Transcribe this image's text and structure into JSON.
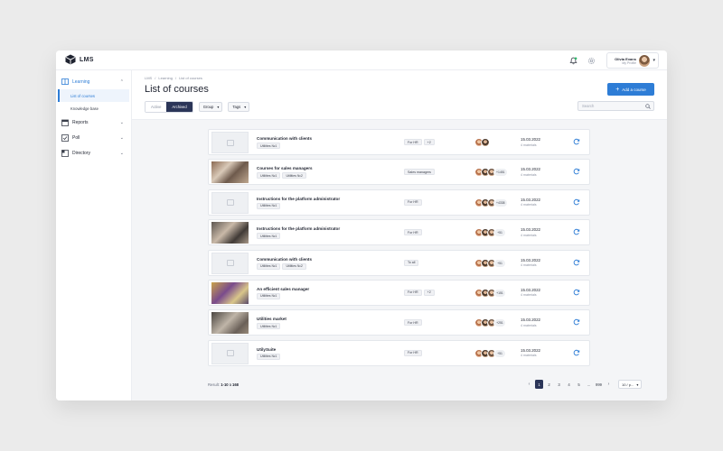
{
  "app": {
    "logo_text": "LMS"
  },
  "profile": {
    "name": "Olivia Evans",
    "subtitle": "My Profile"
  },
  "sidebar": {
    "groups": [
      {
        "label": "Learning",
        "items": [
          {
            "label": "List of courses"
          },
          {
            "label": "Knowledge base"
          }
        ]
      },
      {
        "label": "Reports"
      },
      {
        "label": "Poll"
      },
      {
        "label": "Directory"
      }
    ]
  },
  "breadcrumb": [
    "LMS",
    "/",
    "Learning",
    "/",
    "List of courses"
  ],
  "header": {
    "title": "List of courses",
    "add_button": "Add a course",
    "status_tabs": [
      "Active",
      "Archived"
    ],
    "active_tab": "Archived",
    "group_filter": "Group",
    "tags_filter": "Tags",
    "search_placeholder": "Search"
  },
  "courses": [
    {
      "title": "Communication with clients",
      "tags": [
        "Utilities №1"
      ],
      "groups": [
        "For HR",
        "+2"
      ],
      "participants_extra": "",
      "avatar_count": 2,
      "date": "15.03.2022",
      "materials": "4 materials",
      "photo": false
    },
    {
      "title": "Courses for sales managers",
      "tags": [
        "Utilities №1",
        "Utilities №2"
      ],
      "groups": [
        "Sales managers"
      ],
      "participants_extra": "+1451",
      "avatar_count": 3,
      "date": "15.03.2022",
      "materials": "4 materials",
      "photo": true
    },
    {
      "title": "Instructions for the platform administrator",
      "tags": [
        "Utilities №1"
      ],
      "groups": [
        "For HR"
      ],
      "participants_extra": "+4338",
      "avatar_count": 3,
      "date": "15.03.2022",
      "materials": "4 materials",
      "photo": false
    },
    {
      "title": "Instructions for the platform administrator",
      "tags": [
        "Utilities №1"
      ],
      "groups": [
        "For HR"
      ],
      "participants_extra": "+51",
      "avatar_count": 3,
      "date": "15.03.2022",
      "materials": "4 materials",
      "photo": true
    },
    {
      "title": "Communication with clients",
      "tags": [
        "Utilities №1",
        "Utilities №2"
      ],
      "groups": [
        "To all"
      ],
      "participants_extra": "+51",
      "avatar_count": 3,
      "date": "15.03.2022",
      "materials": "4 materials",
      "photo": false
    },
    {
      "title": "An efficient sales manager",
      "tags": [
        "Utilities №1"
      ],
      "groups": [
        "For HR",
        "+2"
      ],
      "participants_extra": "+151",
      "avatar_count": 3,
      "date": "15.03.2022",
      "materials": "4 materials",
      "photo": true
    },
    {
      "title": "Utilities market",
      "tags": [
        "Utilities №1"
      ],
      "groups": [
        "For HR"
      ],
      "participants_extra": "+251",
      "avatar_count": 3,
      "date": "15.03.2022",
      "materials": "4 materials",
      "photo": true
    },
    {
      "title": "UtilySuite",
      "tags": [
        "Utilities №1"
      ],
      "groups": [
        "For HR"
      ],
      "participants_extra": "+51",
      "avatar_count": 3,
      "date": "15.03.2022",
      "materials": "4 materials",
      "photo": false
    }
  ],
  "footer": {
    "result_label": "Result:",
    "result_value": "1-10 з 168",
    "pages": [
      "1",
      "2",
      "3",
      "4",
      "5",
      "...",
      "999"
    ],
    "current_page": "1",
    "per_page": "10 / p..."
  },
  "colors": {
    "accent": "#2e7dd6",
    "selected_dark": "#2b3558"
  }
}
